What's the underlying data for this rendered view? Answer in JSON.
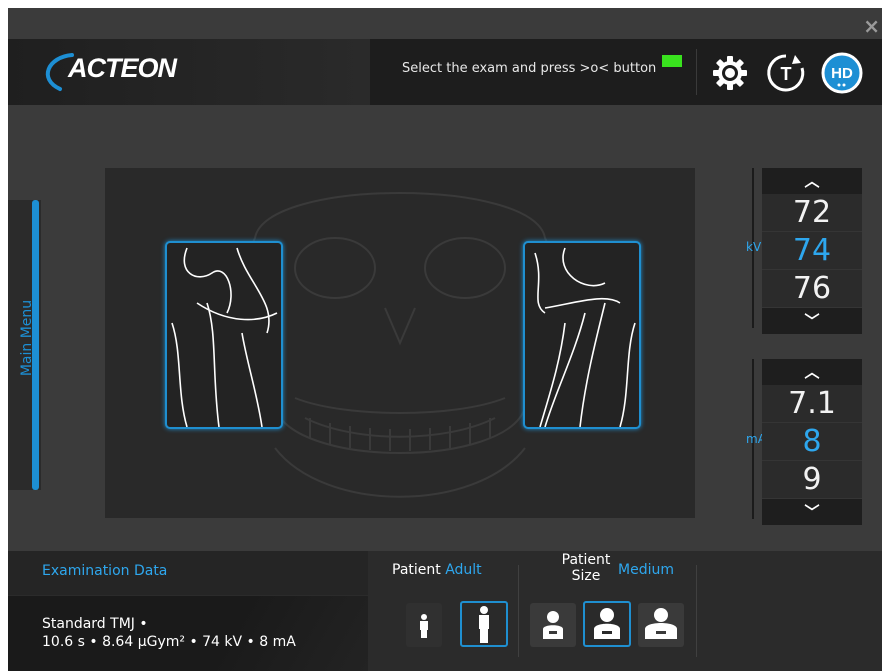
{
  "window": {
    "close_label": "×"
  },
  "header": {
    "logo": "ACTEON",
    "hint": "Select the exam and press >o< button",
    "icons": [
      "gear-icon",
      "timer-icon",
      "hd-icon"
    ],
    "hd_label": "HD",
    "timer_label": "T",
    "led_color": "#39e21e"
  },
  "sidebar": {
    "main_menu_label": "Main Menu"
  },
  "kv": {
    "label": "kV",
    "values": [
      "72",
      "74",
      "76"
    ],
    "selected": "74"
  },
  "ma": {
    "label": "mA",
    "values": [
      "7.1",
      "8",
      "9"
    ],
    "selected": "8"
  },
  "exam": {
    "title": "Examination Data",
    "line1": "Standard TMJ •",
    "line2": "10.6 s • 8.64 µGym² • 74 kV • 8 mA"
  },
  "patient": {
    "label": "Patient",
    "value": "Adult"
  },
  "patient_size": {
    "label_line1": "Patient",
    "label_line2": "Size",
    "value": "Medium"
  },
  "colors": {
    "accent": "#1f8fd0",
    "accent_text": "#2ea7ee",
    "background": "#3b3b3b"
  }
}
